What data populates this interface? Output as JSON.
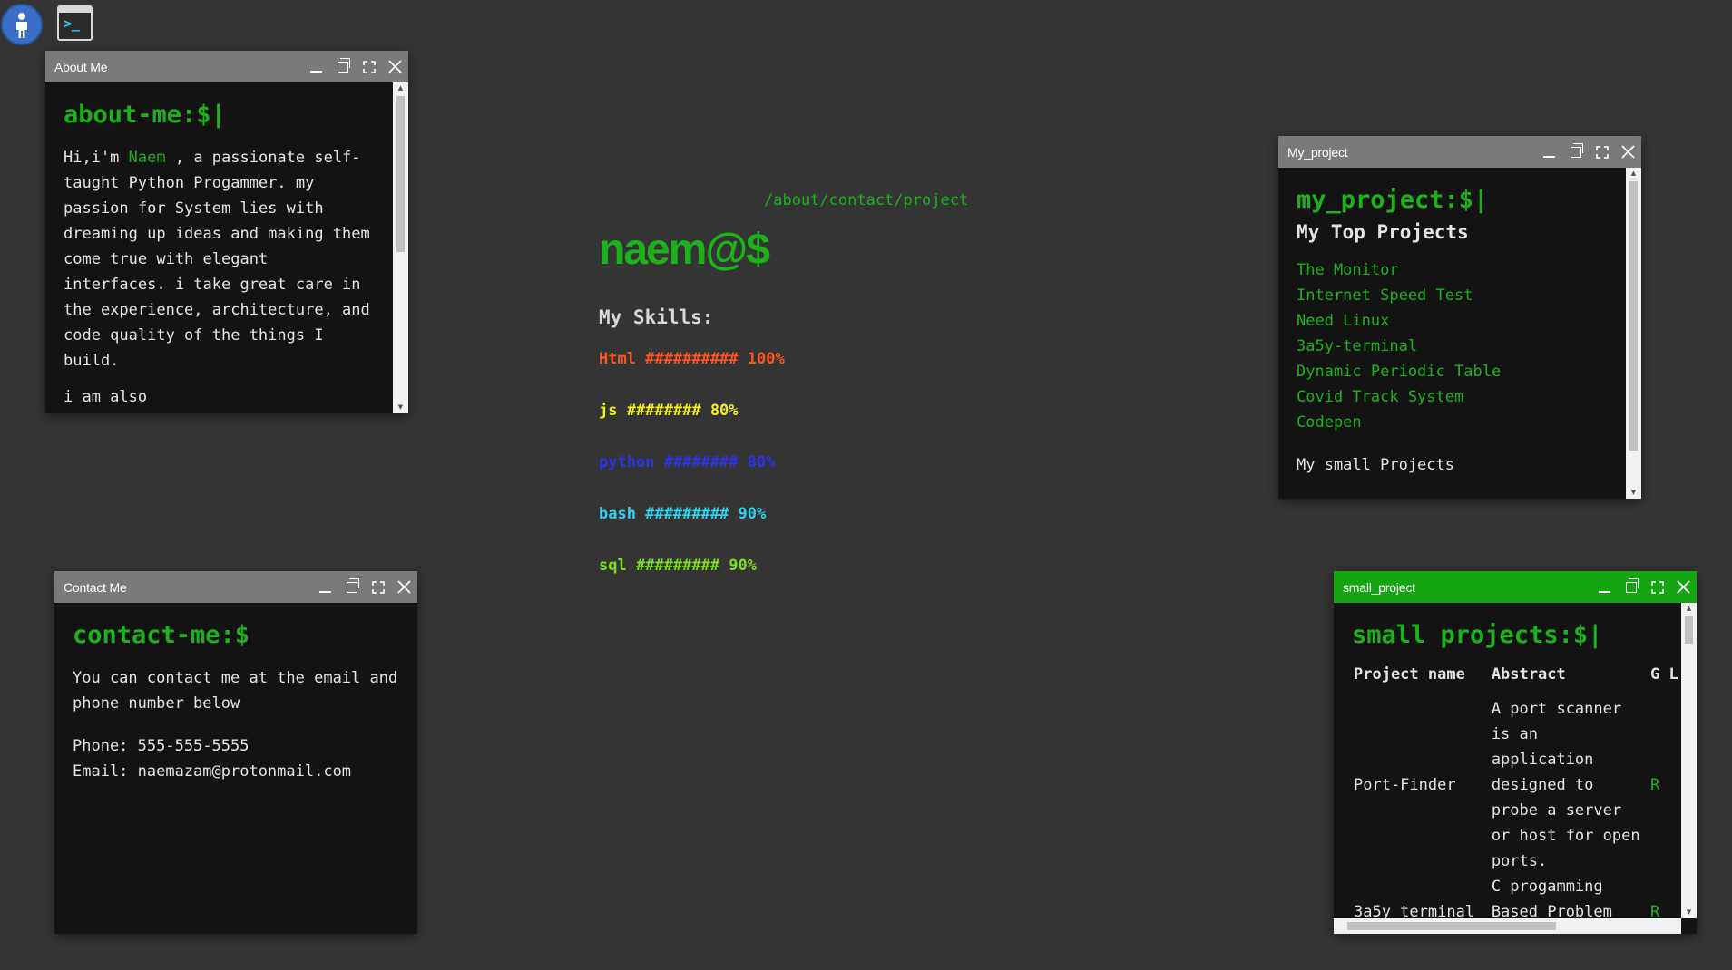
{
  "nav": {
    "path": "/about/contact/project"
  },
  "brand": "naem@$",
  "skills": {
    "heading": "My Skills:",
    "items": [
      {
        "text": "Html ########## 100%",
        "color": "#ff5722"
      },
      {
        "text": "js ######## 80%",
        "color": "#f3f022"
      },
      {
        "text": "python ######## 80%",
        "color": "#2a34e8"
      },
      {
        "text": "bash ######### 90%",
        "color": "#2ed4f0"
      },
      {
        "text": "sql ######### 90%",
        "color": "#7ee022"
      }
    ]
  },
  "about": {
    "title": "About Me",
    "prompt": "about-me:$|",
    "intro_pre": "Hi,i'm ",
    "name": "Naem",
    "intro_post": " , a passionate self-taught Python Progammer. my passion for System lies with dreaming up ideas and making them come true with elegant interfaces. i take great care in the experience, architecture, and code quality of the things I build.",
    "more": "i am also"
  },
  "contact": {
    "title": "Contact Me",
    "prompt": "contact-me:$",
    "text": "You can contact me at the email and phone number below",
    "phone": "Phone: 555-555-5555",
    "email": "Email: naemazam@protonmail.com"
  },
  "project": {
    "title": "My_project",
    "prompt": "my_project:$|",
    "heading": "My Top Projects",
    "links": [
      "The Monitor",
      "Internet Speed Test",
      "Need Linux",
      "3a5y-terminal",
      "Dynamic Periodic Table",
      "Covid Track System",
      "Codepen"
    ],
    "small_heading": "My small Projects"
  },
  "small": {
    "title": "small_project",
    "prompt": "small projects:$|",
    "col_name": "Project name",
    "col_abstract": "Abstract",
    "col_link": "G L",
    "rows": [
      {
        "name": "Port-Finder",
        "abstract": "A port scanner is an application designed to probe a server or host for open ports.",
        "link": "R"
      },
      {
        "name": "3a5y terminal",
        "abstract": "C progamming Based Problem Solving Terminal",
        "link": "R"
      }
    ]
  },
  "icons": {
    "user": "user-icon",
    "terminal": "terminal-icon"
  }
}
